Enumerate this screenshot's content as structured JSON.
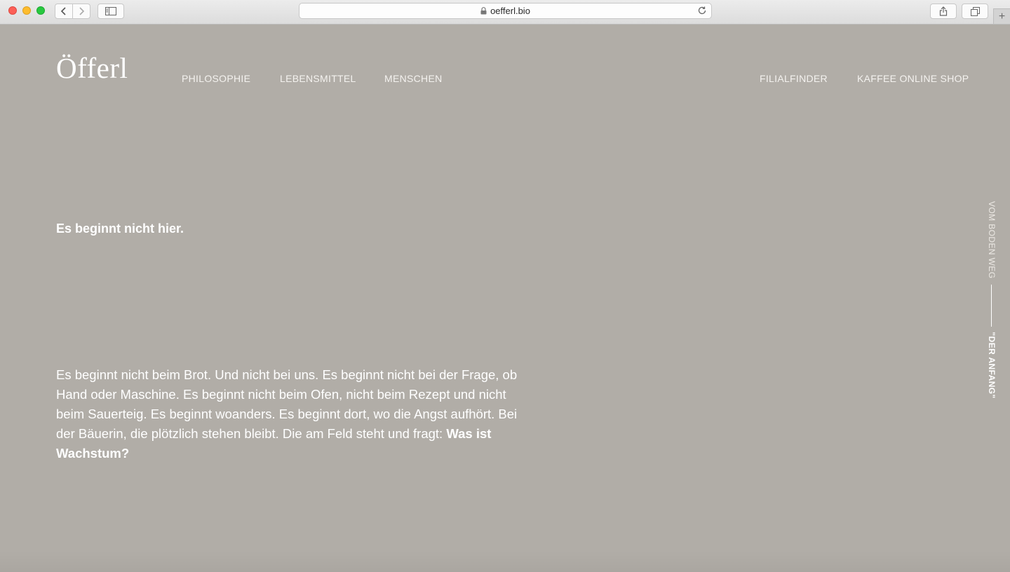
{
  "browser": {
    "url": "oefferl.bio"
  },
  "site": {
    "logo": "Öfferl",
    "nav_left": [
      "PHILOSOPHIE",
      "LEBENSMITTEL",
      "MENSCHEN"
    ],
    "nav_right": [
      "FILIALFINDER",
      "KAFFEE ONLINE SHOP"
    ]
  },
  "content": {
    "headline": "Es beginnt nicht hier.",
    "body": "Es beginnt nicht beim Brot. Und nicht bei uns. Es beginnt nicht bei der Frage, ob Hand oder Maschine. Es beginnt nicht beim Ofen, nicht beim Rezept und nicht beim Sauerteig. Es beginnt woanders. Es beginnt dort, wo die Angst aufhört. Bei der Bäuerin, die plötzlich stehen bleibt. Die am Feld steht und fragt:",
    "body_emphasis": "Was ist Wachstum?"
  },
  "side_label": {
    "section": "VOM BODEN WEG",
    "chapter": "\"DER ANFANG\""
  },
  "colors": {
    "page_background": "#b1ada7",
    "text": "#ffffff"
  }
}
